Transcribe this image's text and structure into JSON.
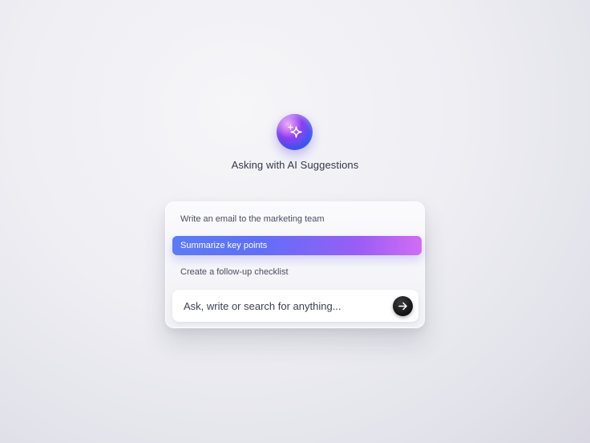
{
  "header": {
    "icon": "sparkle-icon",
    "title": "Asking with AI Suggestions"
  },
  "suggestions": [
    {
      "label": "Write an email to the marketing team",
      "selected": false
    },
    {
      "label": "Summarize key points",
      "selected": true
    },
    {
      "label": "Create a follow-up checklist",
      "selected": false
    }
  ],
  "search": {
    "placeholder": "Ask, write or search for anything...",
    "value": "",
    "submit_icon": "arrow-right-icon"
  },
  "colors": {
    "accent_gradient_start": "#5b7cf6",
    "accent_gradient_end": "#d06df5",
    "orb_magenta": "#d14cf0",
    "orb_blue": "#2e8cf7",
    "send_button": "#121214"
  }
}
